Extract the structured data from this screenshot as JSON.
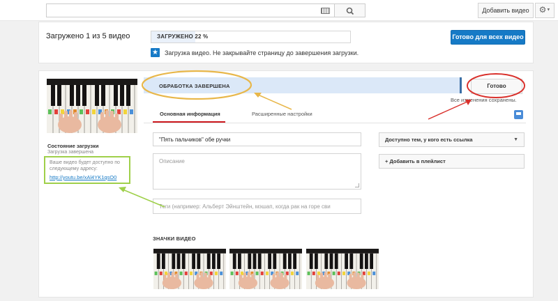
{
  "header": {
    "search_placeholder": "",
    "add_video_label": "Добавить видео",
    "settings_icon": "⚙"
  },
  "upload": {
    "title": "Загружено 1 из 5 видео",
    "progress_label": "ЗАГРУЖЕНО 22 %",
    "progress_percent": 22,
    "done_all_label": "Готово для всех видео",
    "notice": "Загрузка видео. Не закрывайте страницу до завершения загрузки."
  },
  "video": {
    "status_label": "ОБРАБОТКА ЗАВЕРШЕНА",
    "done_label": "Готово",
    "saved_note": "Все изменения сохранены.",
    "upload_state_title": "Состояние загрузки",
    "upload_state_value": "Загрузка завершена",
    "url_note": "Ваше видео будет доступно по следующему адресу:",
    "url": "http://youtu.be/xAl4YK1qsO0",
    "tabs": [
      {
        "label": "Основная информация"
      },
      {
        "label": "Расширенные настройки"
      }
    ],
    "title_value": "\"Пять пальчиков\" обе ручки",
    "description_placeholder": "Описание",
    "tags_placeholder": "Теги (например: Альберт Эйнштейн, мэшап, когда рак на горе сви",
    "privacy_value": "Доступно тем, у кого есть ссылка",
    "playlist_label": "+ Добавить в плейлист",
    "thumbnails_title": "ЗНАЧКИ ВИДЕО"
  },
  "colors": {
    "accent_blue": "#167ac6",
    "annotation_orange": "#e8b74a",
    "annotation_red": "#d9302b",
    "annotation_green": "#9fd04a"
  }
}
